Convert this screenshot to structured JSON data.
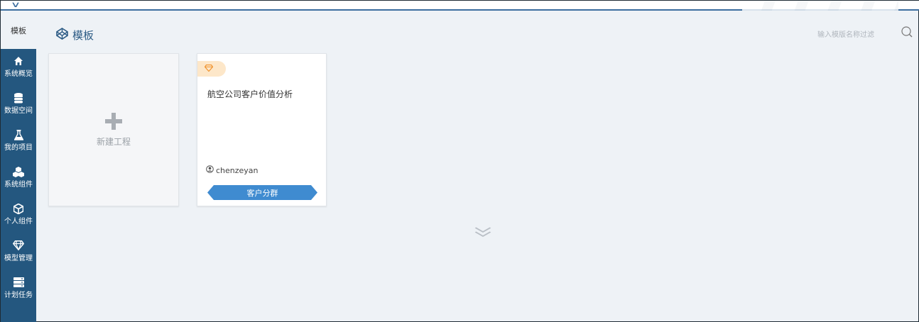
{
  "sidebar": {
    "header_label": "模板",
    "items": [
      {
        "label": "系统概览",
        "icon": "home-icon"
      },
      {
        "label": "数据空间",
        "icon": "database-icon"
      },
      {
        "label": "我的项目",
        "icon": "flask-icon"
      },
      {
        "label": "系统组件",
        "icon": "cubes-icon"
      },
      {
        "label": "个人组件",
        "icon": "cube-icon"
      },
      {
        "label": "模型管理",
        "icon": "diamond-icon"
      },
      {
        "label": "计划任务",
        "icon": "server-icon"
      }
    ]
  },
  "page": {
    "title": "模板",
    "title_icon": "codepen-icon"
  },
  "search": {
    "placeholder": "输入模版名称过滤",
    "icon": "search-icon"
  },
  "new_project": {
    "label": "新建工程",
    "icon": "plus-icon"
  },
  "templates": [
    {
      "title": "航空公司客户价值分析",
      "author": "chenzeyan",
      "tag": "客户分群",
      "badge_icon": "diamond-icon"
    }
  ],
  "load_more_icon": "double-chevron-down-icon",
  "colors": {
    "sidebar_bg": "#24577f",
    "accent": "#2c5b85",
    "tag_bg": "#3f8bd0",
    "badge_bg": "#fde7c9",
    "badge_icon": "#f0932e",
    "page_bg": "#eef2f6"
  }
}
